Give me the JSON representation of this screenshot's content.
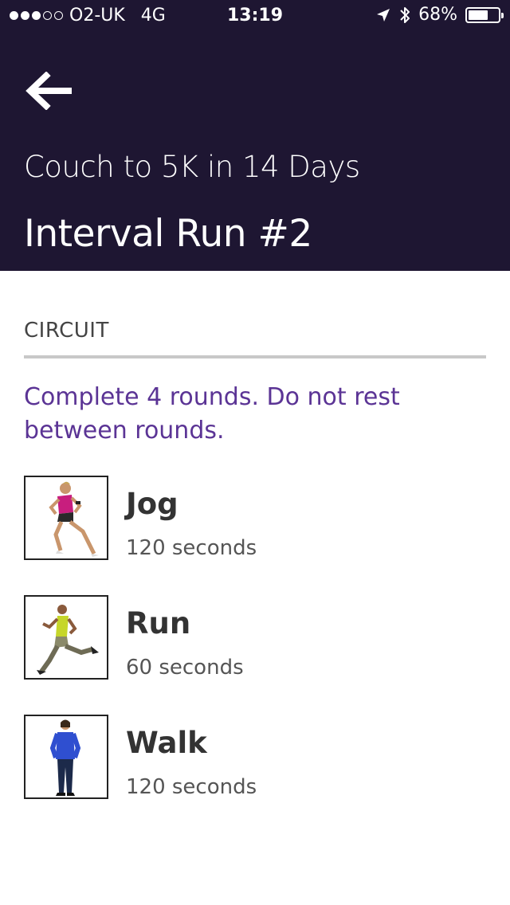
{
  "status_bar": {
    "carrier": "O2-UK",
    "network": "4G",
    "time": "13:19",
    "battery": "68%",
    "battery_level": 0.68
  },
  "header": {
    "subtitle": "Couch to 5K in 14 Days",
    "title": "Interval Run #2",
    "background_color": "#1e1632"
  },
  "circuit": {
    "section_label": "CIRCUIT",
    "instruction": "Complete 4 rounds. Do not rest between rounds.",
    "accent_color": "#5b3495",
    "exercises": [
      {
        "name": "Jog",
        "duration": "120 seconds",
        "thumbnail": "woman-jogging-pink-top"
      },
      {
        "name": "Run",
        "duration": "60 seconds",
        "thumbnail": "man-running-yellow-top"
      },
      {
        "name": "Walk",
        "duration": "120 seconds",
        "thumbnail": "woman-walking-blue-jacket"
      }
    ]
  }
}
